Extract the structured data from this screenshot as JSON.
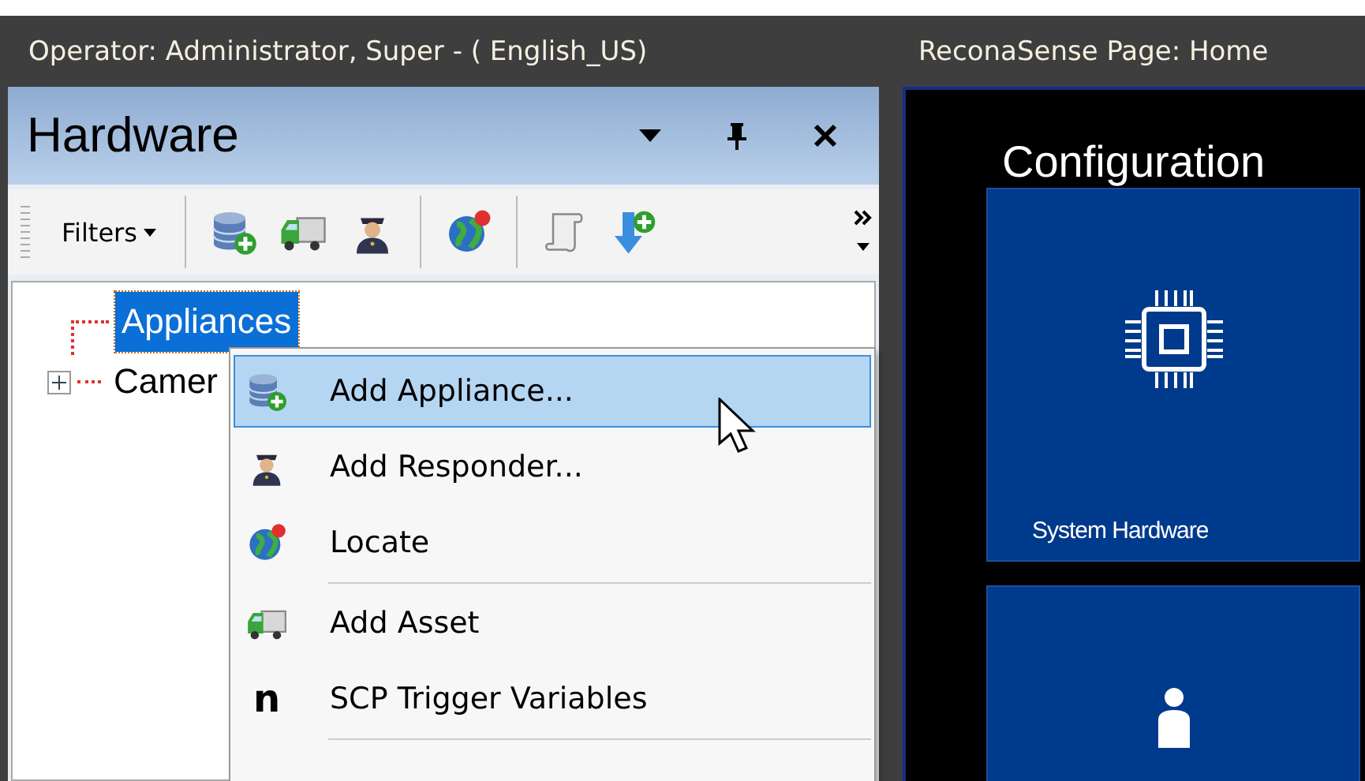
{
  "title_bar": {
    "operator": "Operator: Administrator, Super - ( English_US)",
    "page": "ReconaSense Page: Home"
  },
  "hardware_panel": {
    "title": "Hardware",
    "toolbar": {
      "filters": "Filters"
    },
    "tree": [
      {
        "label": "Appliances",
        "selected": true,
        "expandable": false
      },
      {
        "label": "Camer",
        "selected": false,
        "expandable": true
      }
    ]
  },
  "context_menu": [
    {
      "kind": "item",
      "label": "Add Appliance...",
      "selected": true
    },
    {
      "kind": "item",
      "label": "Add Responder...",
      "selected": false
    },
    {
      "kind": "item",
      "label": "Locate",
      "selected": false
    },
    {
      "kind": "separator"
    },
    {
      "kind": "item",
      "label": "Add Asset",
      "selected": false
    },
    {
      "kind": "item",
      "label": "SCP Trigger Variables",
      "selected": false,
      "glyph": "n"
    },
    {
      "kind": "separator"
    }
  ],
  "configuration": {
    "title": "Configuration",
    "tiles": [
      {
        "kind": "hardware",
        "label": "System Hardware"
      },
      {
        "kind": "person"
      }
    ]
  }
}
